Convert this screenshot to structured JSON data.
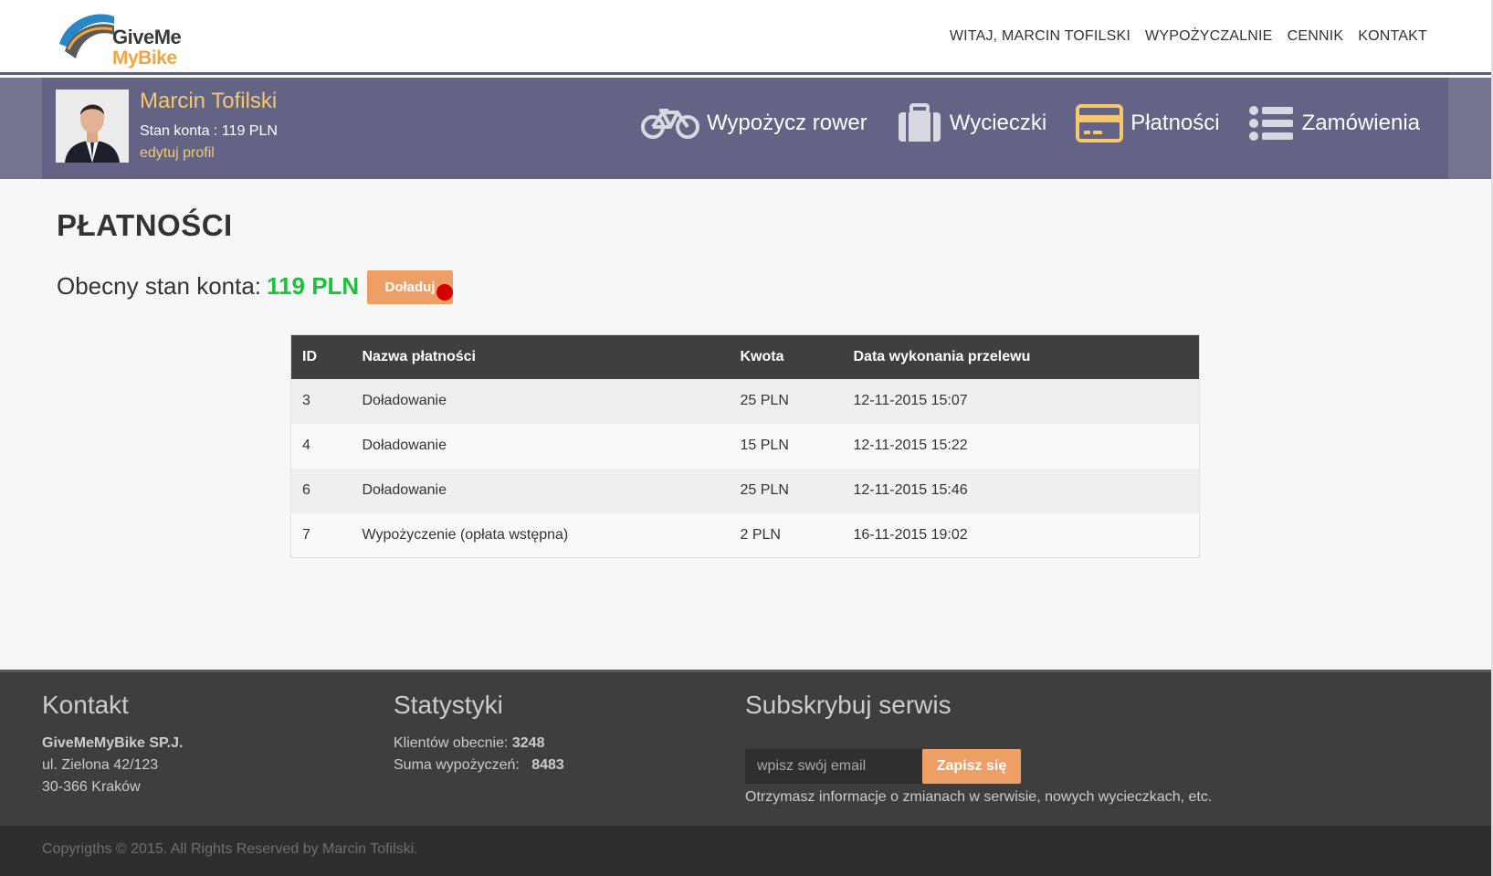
{
  "brand": {
    "logo_text_1": "GiveMe",
    "logo_text_2": "MyBike",
    "colors": {
      "accent": "#ee9f66",
      "band": "#636385",
      "name": "#f6c86b",
      "balance_green": "#1fbf3f"
    }
  },
  "topnav": [
    {
      "label": "WITAJ, MARCIN TOFILSKI"
    },
    {
      "label": "WYPOŻYCZALNIE"
    },
    {
      "label": "CENNIK"
    },
    {
      "label": "KONTAKT"
    }
  ],
  "profile": {
    "name": "Marcin Tofilski",
    "balance": "Stan konta : 119 PLN",
    "edit_link": "edytuj profil"
  },
  "main_nav": [
    {
      "icon": "bicycle-icon",
      "label": "Wypożycz rower"
    },
    {
      "icon": "suitcase-icon",
      "label": "Wycieczki"
    },
    {
      "icon": "credit-card-icon",
      "label": "Płatności"
    },
    {
      "icon": "list-icon",
      "label": "Zamówienia"
    }
  ],
  "page": {
    "title": "PŁATNOŚCI",
    "balance_label": "Obecny stan konta:",
    "balance_value": "119 PLN",
    "topup_label": "Doładuj"
  },
  "payments_table": {
    "columns": [
      "ID",
      "Nazwa płatności",
      "Kwota",
      "Data wykonania przelewu"
    ],
    "rows": [
      [
        "3",
        "Doładowanie",
        "25 PLN",
        "12-11-2015 15:07"
      ],
      [
        "4",
        "Doładowanie",
        "15 PLN",
        "12-11-2015 15:22"
      ],
      [
        "6",
        "Doładowanie",
        "25 PLN",
        "12-11-2015 15:46"
      ],
      [
        "7",
        "Wypożyczenie (opłata wstępna)",
        "2 PLN",
        "16-11-2015 19:02"
      ]
    ]
  },
  "footer": {
    "contact": {
      "title": "Kontakt",
      "company": "GiveMeMyBike SP.J.",
      "street": "ul. Zielona 42/123",
      "city": "30-366 Kraków"
    },
    "stats": {
      "title": "Statystyki",
      "clients_label": "Klientów obecnie:",
      "clients_value": "3248",
      "rentals_label": "Suma wypożyczeń:",
      "rentals_value": "8483"
    },
    "subscribe": {
      "title": "Subskrybuj serwis",
      "email_placeholder": "wpisz swój email",
      "button_label": "Zapisz się",
      "note": "Otrzymasz informacje o zmianach w serwisie, nowych wycieczkach, etc."
    },
    "copyright": "Copyrigths © 2015. All Rights Reserved by Marcin Tofilski."
  }
}
